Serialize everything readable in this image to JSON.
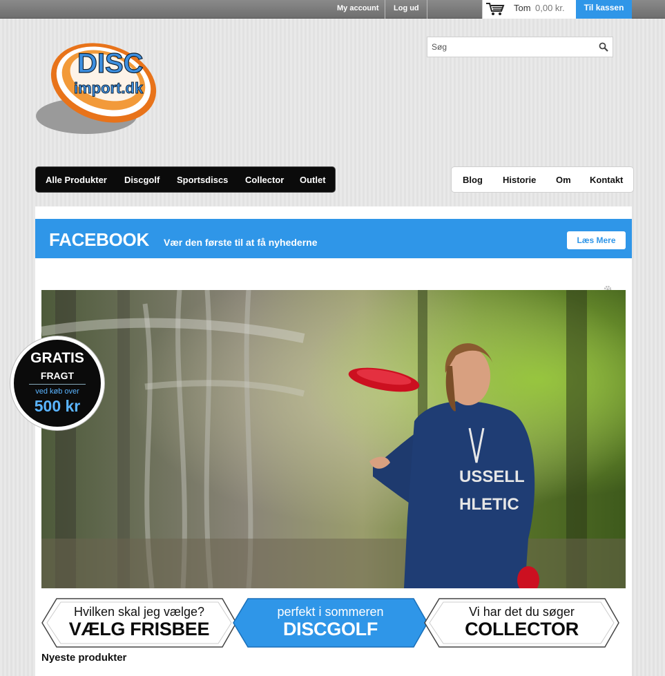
{
  "topbar": {
    "my_account": "My account",
    "logout": "Log ud",
    "cart_label": "Tom",
    "cart_value": "0,00 kr.",
    "checkout": "Til kassen"
  },
  "logo": {
    "line1": "DISC",
    "line2": "import.dk"
  },
  "search": {
    "placeholder": "Søg"
  },
  "mainnav": [
    "Alle Produkter",
    "Discgolf",
    "Sportsdiscs",
    "Collector",
    "Outlet"
  ],
  "rightnav": [
    "Blog",
    "Historie",
    "Om",
    "Kontakt"
  ],
  "facebook": {
    "title": "FACEBOOK",
    "text": "Vær den første til at få nyhederne",
    "button": "Læs Mere"
  },
  "badge": {
    "line1": "GRATIS",
    "line2": "FRAGT",
    "line3": "ved køb over",
    "line4": "500 kr"
  },
  "hero": {
    "shirt_text1": "USSELL",
    "shirt_text2": "HLETIC"
  },
  "banners": [
    {
      "small": "Hvilken skal jeg vælge?",
      "big": "VÆLG FRISBEE"
    },
    {
      "small": "perfekt i sommeren",
      "big": "DISCGOLF"
    },
    {
      "small": "Vi har det du søger",
      "big": "COLLECTOR"
    }
  ],
  "newest_heading": "Nyeste produkter",
  "colors": {
    "accent": "#2f96e8",
    "nav_dark": "#0b0b0b",
    "logo_orange": "#f07c1e"
  }
}
